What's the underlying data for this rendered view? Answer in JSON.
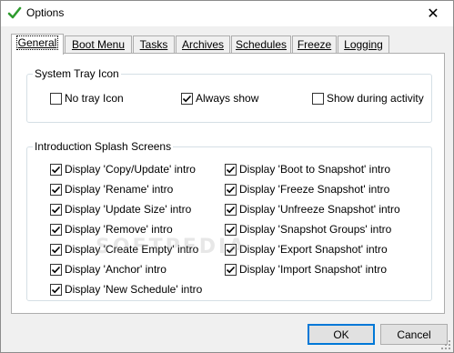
{
  "window": {
    "title": "Options",
    "close_glyph": "✕"
  },
  "tabs": [
    {
      "label": "General",
      "active": true
    },
    {
      "label": "Boot Menu",
      "active": false
    },
    {
      "label": "Tasks",
      "active": false
    },
    {
      "label": "Archives",
      "active": false
    },
    {
      "label": "Schedules",
      "active": false
    },
    {
      "label": "Freeze",
      "active": false
    },
    {
      "label": "Logging",
      "active": false
    }
  ],
  "tray_group": {
    "title": "System Tray Icon",
    "options": [
      {
        "label": "No tray Icon",
        "checked": false
      },
      {
        "label": "Always show",
        "checked": true
      },
      {
        "label": "Show during activity",
        "checked": false
      }
    ]
  },
  "splash_group": {
    "title": "Introduction Splash Screens",
    "left": [
      {
        "label": "Display 'Copy/Update' intro",
        "checked": true
      },
      {
        "label": "Display 'Rename' intro",
        "checked": true
      },
      {
        "label": "Display 'Update Size' intro",
        "checked": true
      },
      {
        "label": "Display 'Remove' intro",
        "checked": true
      },
      {
        "label": "Display 'Create Empty' intro",
        "checked": true
      },
      {
        "label": "Display 'Anchor' intro",
        "checked": true
      },
      {
        "label": "Display 'New Schedule' intro",
        "checked": true
      }
    ],
    "right": [
      {
        "label": "Display 'Boot to Snapshot' intro",
        "checked": true
      },
      {
        "label": "Display 'Freeze Snapshot' intro",
        "checked": true
      },
      {
        "label": "Display 'Unfreeze Snapshot' intro",
        "checked": true
      },
      {
        "label": "Display 'Snapshot Groups' intro",
        "checked": true
      },
      {
        "label": "Display 'Export Snapshot' intro",
        "checked": true
      },
      {
        "label": "Display 'Import Snapshot' intro",
        "checked": true
      }
    ]
  },
  "watermark": "SOFTPEDIA",
  "buttons": {
    "ok": "OK",
    "cancel": "Cancel"
  },
  "colors": {
    "accent": "#0078d7",
    "app_icon": "#2e9b2e"
  }
}
